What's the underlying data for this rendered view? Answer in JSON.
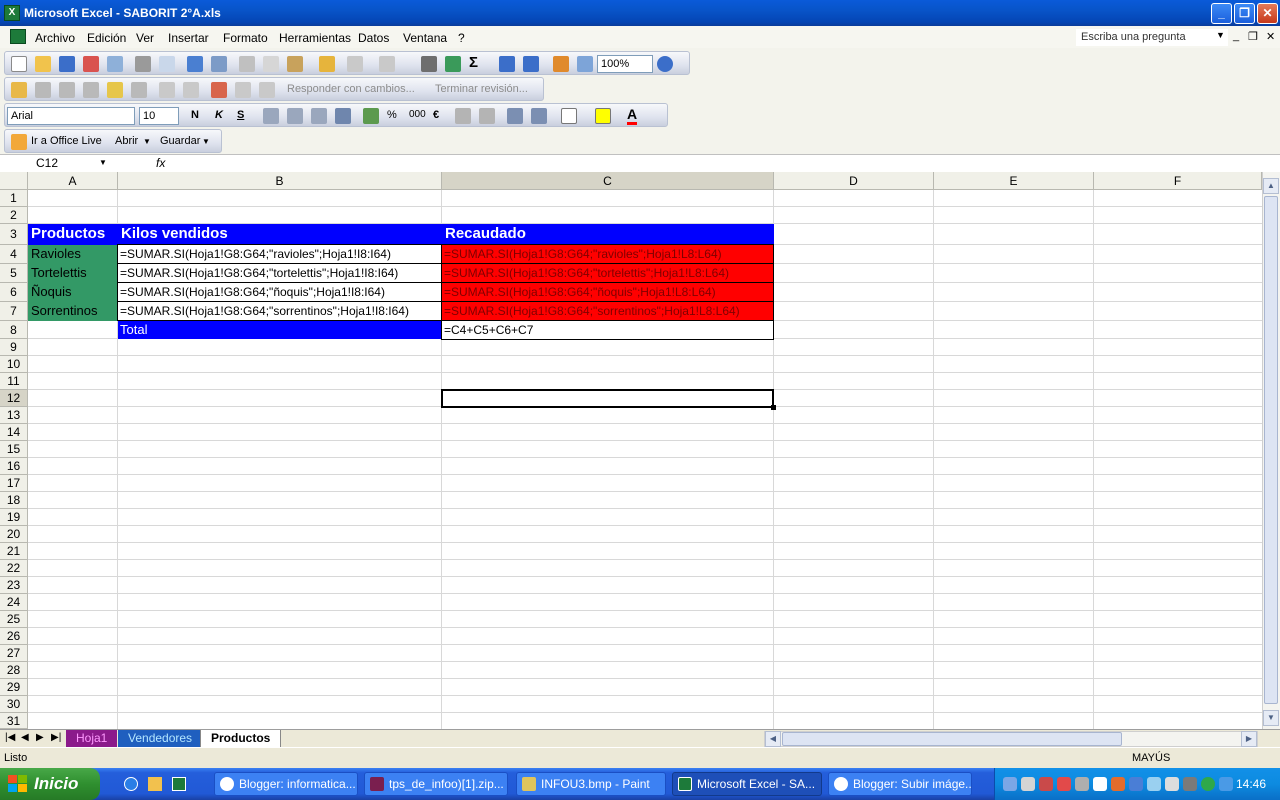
{
  "window": {
    "title": "Microsoft Excel - SABORIT 2°A.xls"
  },
  "menu": {
    "items": [
      "Archivo",
      "Edición",
      "Ver",
      "Insertar",
      "Formato",
      "Herramientas",
      "Datos",
      "Ventana",
      "?"
    ],
    "ask_placeholder": "Escriba una pregunta"
  },
  "toolbar": {
    "zoom": "100%",
    "font_name": "Arial",
    "font_size": "10",
    "reviewing_reply": "Responder con cambios...",
    "reviewing_end": "Terminar revisión...",
    "office_live": "Ir a Office Live",
    "open": "Abrir",
    "save": "Guardar"
  },
  "formula_bar": {
    "name_box": "C12",
    "fx": "fx",
    "formula": ""
  },
  "grid": {
    "columns": [
      "A",
      "B",
      "C",
      "D",
      "E",
      "F"
    ],
    "selected_column": "C",
    "rows": [
      "1",
      "2",
      "3",
      "4",
      "5",
      "6",
      "7",
      "8",
      "9",
      "10",
      "11",
      "12",
      "13",
      "14",
      "15",
      "16",
      "17",
      "18",
      "19",
      "20",
      "21",
      "22",
      "23",
      "24",
      "25",
      "26",
      "27",
      "28",
      "29",
      "30",
      "31"
    ],
    "selected_row": "12",
    "cells": {
      "A3": "Productos",
      "B3": "Kilos vendidos",
      "C3": "Recaudado",
      "A4": "Ravioles",
      "B4": "=SUMAR.SI(Hoja1!G8:G64;\"ravioles\";Hoja1!I8:I64)",
      "C4": "=SUMAR.SI(Hoja1!G8:G64;\"ravioles\";Hoja1!L8:L64)",
      "A5": "Tortelettis",
      "B5": "=SUMAR.SI(Hoja1!G8:G64;\"tortelettis\";Hoja1!I8:I64)",
      "C5": "=SUMAR.SI(Hoja1!G8:G64;\"tortelettis\";Hoja1!L8:L64)",
      "A6": "Ñoquis",
      "B6": "=SUMAR.SI(Hoja1!G8:G64;\"ñoquis\";Hoja1!I8:I64)",
      "C6": "=SUMAR.SI(Hoja1!G8:G64;\"ñoquis\";Hoja1!L8:L64)",
      "A7": "Sorrentinos",
      "B7": "=SUMAR.SI(Hoja1!G8:G64;\"sorrentinos\";Hoja1!I8:I64)",
      "C7": "=SUMAR.SI(Hoja1!G8:G64;\"sorrentinos\";Hoja1!L8:L64)",
      "B8": "Total",
      "C8": "=C4+C5+C6+C7"
    }
  },
  "sheets": {
    "tabs": [
      "Hoja1",
      "Vendedores",
      "Productos"
    ],
    "active": "Productos"
  },
  "status": {
    "left": "Listo",
    "caps": "MAYÚS"
  },
  "taskbar": {
    "start": "Inicio",
    "tasks": [
      "Blogger: informatica...",
      "tps_de_infoo)[1].zip...",
      "INFOU3.bmp - Paint",
      "Microsoft Excel - SA...",
      "Blogger: Subir imáge..."
    ],
    "clock": "14:46"
  },
  "colors": {
    "header_blue": "#0000ff",
    "product_green": "#339966",
    "result_red": "#ff0000"
  }
}
